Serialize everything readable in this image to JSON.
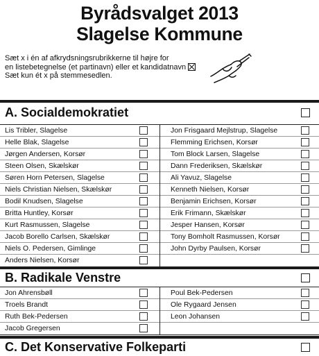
{
  "title_line1": "Byrådsvalget 2013",
  "title_line2": "Slagelse Kommune",
  "instructions": [
    "Sæt x i én af afkrydsningsrubrikkerne til højre for",
    "en listebetegnelse (et partinavn) eller et kandidatnavn",
    "Sæt kun ét x på stemmesedlen."
  ],
  "parties": [
    {
      "name": "A. Socialdemokratiet",
      "left": [
        "Lis Tribler, Slagelse",
        "Helle Blak, Slagelse",
        "Jørgen Andersen, Korsør",
        "Steen Olsen, Skælskør",
        "Søren Horn Petersen, Slagelse",
        "Niels Christian Nielsen, Skælskør",
        "Bodil Knudsen, Slagelse",
        "Britta Huntley, Korsør",
        "Kurt Rasmussen, Slagelse",
        "Jacob Borello Carlsen, Skælskør",
        "Niels O. Pedersen, Gimlinge",
        "Anders Nielsen, Korsør"
      ],
      "right": [
        "Jon Frisgaard Mejlstrup, Slagelse",
        "Flemming Erichsen, Korsør",
        "Tom Block Larsen, Slagelse",
        "Dann Frederiksen, Skælskør",
        "Ali Yavuz, Slagelse",
        "Kenneth Nielsen, Korsør",
        "Benjamin Erichsen, Korsør",
        "Erik Frimann, Skælskør",
        "Jesper Hansen, Korsør",
        "Tony Bomholt Rasmussen, Korsør",
        "John Dyrby Paulsen, Korsør"
      ]
    },
    {
      "name": "B. Radikale Venstre",
      "left": [
        "Jon Ahrensbøll",
        "Troels Brandt",
        "Ruth Bek-Pedersen",
        "Jacob Gregersen"
      ],
      "right": [
        "Poul Bek-Pedersen",
        "Ole Rygaard Jensen",
        "Leon Johansen"
      ]
    },
    {
      "name": "C. Det Konservative Folkeparti",
      "left": [],
      "right": []
    }
  ]
}
